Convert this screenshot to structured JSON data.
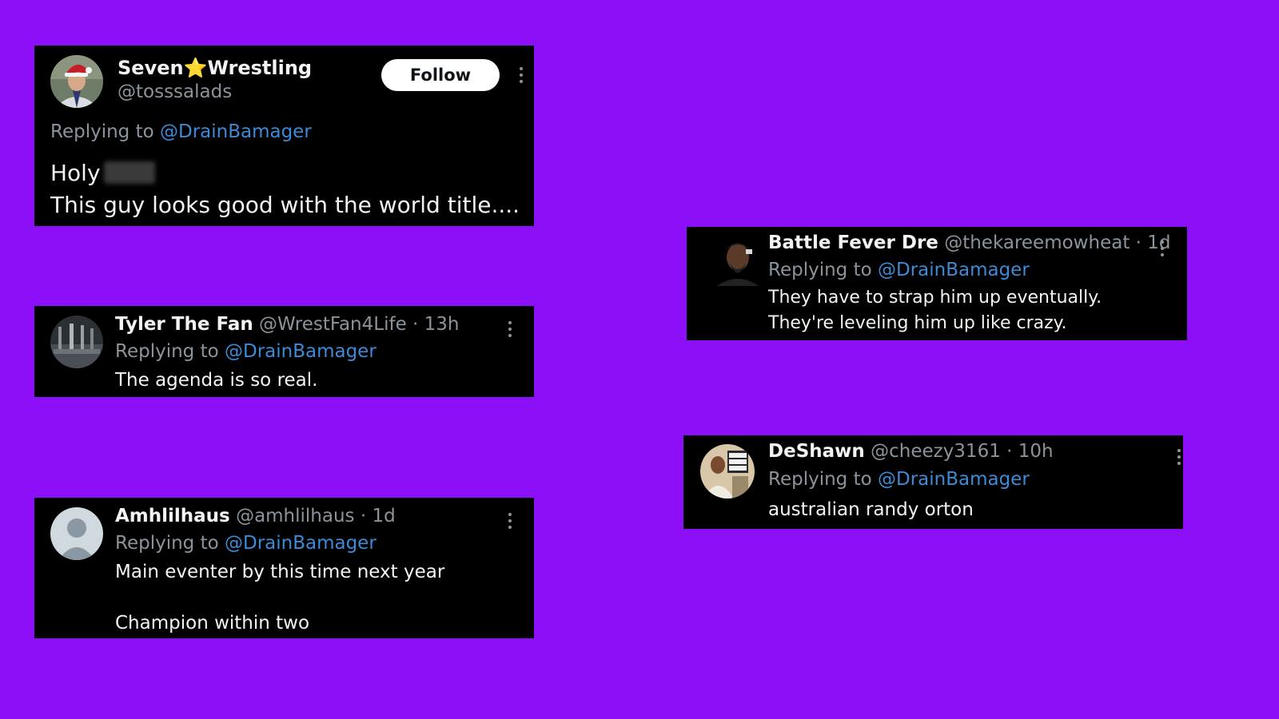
{
  "colors": {
    "background": "#8c0ff8",
    "card": "#000000",
    "mention": "#3d8bd7",
    "muted": "#8b949c",
    "text": "#f1f3f4"
  },
  "reply_prefix": "Replying to ",
  "dot": " · ",
  "posts": {
    "seven": {
      "name": "Seven⭐Wrestling",
      "handle": "@tosssalads",
      "follow_label": "Follow",
      "reply_to": "@DrainBamager",
      "text_line1": "Holy",
      "text_line2": "This guy looks good with the world title....",
      "avatar_icon": "profile-photo-santa-hat"
    },
    "tyler": {
      "name": "Tyler The Fan",
      "handle": "@WrestFan4Life",
      "time": "13h",
      "reply_to": "@DrainBamager",
      "text": "The agenda is so real.",
      "avatar_icon": "profile-photo-crowd"
    },
    "amh": {
      "name": "Amhlilhaus",
      "handle": "@amhlilhaus",
      "time": "1d",
      "reply_to": "@DrainBamager",
      "text_line1": "Main eventer by this time next year",
      "text_line2": "Champion within two",
      "avatar_icon": "default-user-icon"
    },
    "dre": {
      "name": "Battle Fever Dre",
      "handle": "@thekareemowheat",
      "time": "1d",
      "reply_to": "@DrainBamager",
      "text": "They have to strap him up eventually. They're leveling him up like crazy.",
      "avatar_icon": "profile-photo-person"
    },
    "deshawn": {
      "name": "DeShawn",
      "handle": "@cheezy3161",
      "time": "10h",
      "reply_to": "@DrainBamager",
      "text": "australian randy orton",
      "avatar_icon": "profile-photo-game-cover"
    }
  }
}
